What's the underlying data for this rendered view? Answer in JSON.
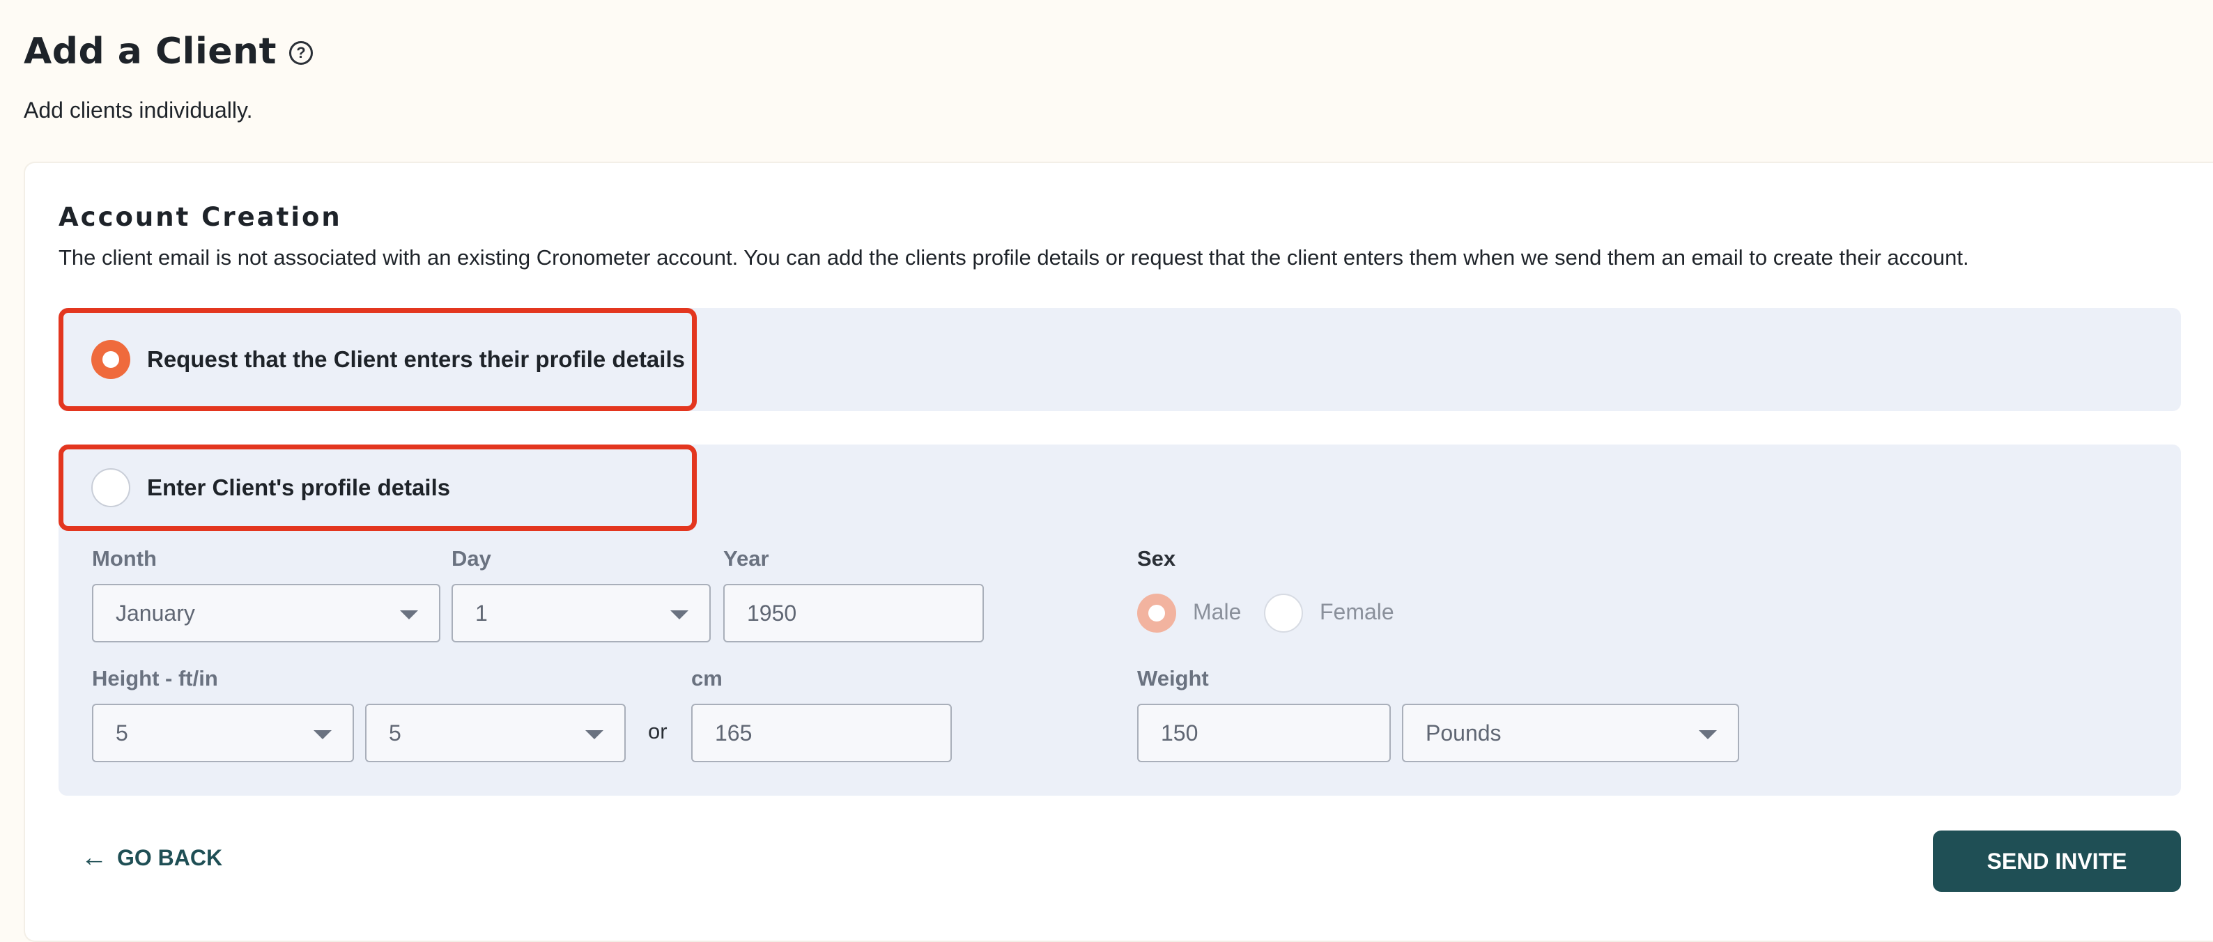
{
  "header": {
    "title": "Add a Client",
    "help_icon": "question-circle-icon",
    "subtitle": "Add clients individually."
  },
  "account_creation": {
    "title": "Account Creation",
    "description": "The client email is not associated with an existing Cronometer account. You can add the clients profile details or request that the client enters them when we send them an email to create their account.",
    "options": [
      {
        "label": "Request that the Client enters their profile details",
        "selected": true
      },
      {
        "label": "Enter Client's profile details",
        "selected": false
      }
    ]
  },
  "profile": {
    "month": {
      "label": "Month",
      "value": "January"
    },
    "day": {
      "label": "Day",
      "value": "1"
    },
    "year": {
      "label": "Year",
      "value": "1950"
    },
    "sex": {
      "label": "Sex",
      "male": "Male",
      "female": "Female",
      "selected": "Male"
    },
    "height": {
      "label": "Height - ft/in",
      "feet": "5",
      "inches": "5",
      "or": "or",
      "cm_label": "cm",
      "cm_value": "165"
    },
    "weight": {
      "label": "Weight",
      "value": "150",
      "unit": "Pounds"
    }
  },
  "footer": {
    "go_back": "GO BACK",
    "go_back_icon": "arrow-left-icon",
    "send_invite": "SEND INVITE"
  },
  "colors": {
    "accent": "#ef6a3c",
    "highlight": "#e3361f",
    "primary_button": "#1f4f55",
    "panel": "#ecf0f8"
  }
}
